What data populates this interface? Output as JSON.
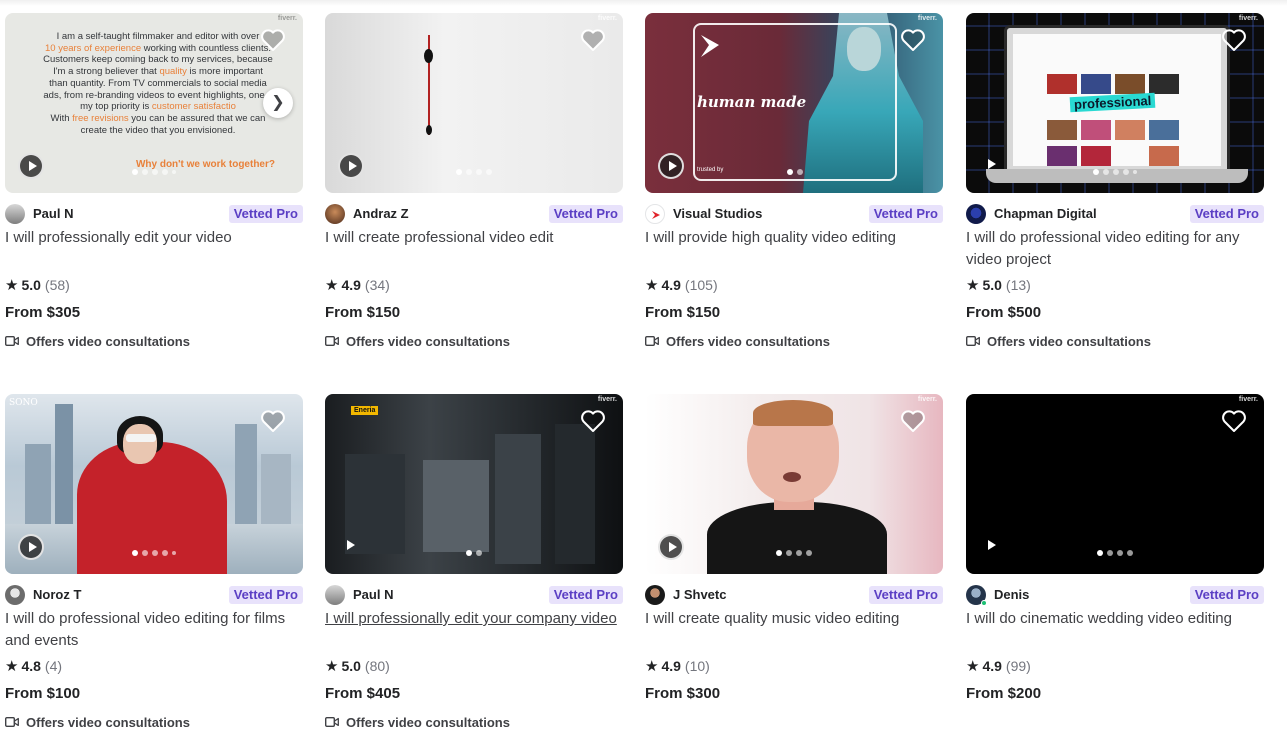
{
  "cards": [
    {
      "seller": "Paul N",
      "badge": "Vetted Pro",
      "title": "I will professionally edit your video",
      "rating": "5.0",
      "reviews": "(58)",
      "price": "From $305",
      "consultations": "Offers video consultations",
      "slide_count": 5,
      "thumbnail_text": {
        "line1": "I am a self-taught filmmaker and editor with over",
        "line2_highlight": "10 years of experience",
        "line2_rest": " working with countless clients.",
        "line3": "Customers keep coming back to my services, because",
        "line4_start": "I'm a strong believer that ",
        "line4_highlight": "quality",
        "line4_end": " is more important",
        "line5": "than quantity. From TV commercials to social media",
        "line6": "ads, from re-branding videos to event highlights, one o",
        "line7": "my top priority is ",
        "line7_highlight": "customer satisfactio",
        "line8_start": "With ",
        "line8_highlight": "free revisions",
        "line8_end": " you can be assured that we can",
        "line9": "create the video that you envisioned.",
        "cta": "Why don't we work together?"
      }
    },
    {
      "seller": "Andraz Z",
      "badge": "Vetted Pro",
      "title": "I will create professional video edit",
      "rating": "4.9",
      "reviews": "(34)",
      "price": "From $150",
      "consultations": "Offers video consultations",
      "slide_count": 4
    },
    {
      "seller": "Visual Studios",
      "badge": "Vetted Pro",
      "title": "I will provide high quality video editing",
      "rating": "4.9",
      "reviews": "(105)",
      "price": "From $150",
      "consultations": "Offers video consultations",
      "slide_count": 2,
      "thumbnail_text": {
        "headline": "human made",
        "trusted": "trusted by"
      }
    },
    {
      "seller": "Chapman Digital",
      "badge": "Vetted Pro",
      "title": "I will do professional video editing for any video project",
      "rating": "5.0",
      "reviews": "(13)",
      "price": "From $500",
      "consultations": "Offers video consultations",
      "slide_count": 5,
      "thumbnail_text": {
        "headline": "professional"
      }
    },
    {
      "seller": "Noroz T",
      "badge": "Vetted Pro",
      "title": "I will do professional video editing for films and events",
      "rating": "4.8",
      "reviews": "(4)",
      "price": "From $100",
      "consultations": "Offers video consultations",
      "slide_count": 5,
      "thumbnail_text": {
        "logo": "SONO"
      }
    },
    {
      "seller": "Paul N",
      "badge": "Vetted Pro",
      "title": "I will professionally edit your company video",
      "rating": "5.0",
      "reviews": "(80)",
      "price": "From $405",
      "consultations": "Offers video consultations",
      "slide_count": 2,
      "thumbnail_text": {
        "label": "Eneria"
      }
    },
    {
      "seller": "J Shvetc",
      "badge": "Vetted Pro",
      "title": "I will create quality music video editing",
      "rating": "4.9",
      "reviews": "(10)",
      "price": "From $300",
      "consultations": "",
      "slide_count": 4
    },
    {
      "seller": "Denis",
      "badge": "Vetted Pro",
      "title": "I will do cinematic wedding video editing",
      "rating": "4.9",
      "reviews": "(99)",
      "price": "From $200",
      "consultations": "",
      "slide_count": 4
    }
  ],
  "watermark": "fiverr.",
  "colors": {
    "badge_bg": "#e8e2fb",
    "badge_text": "#5b3fc4",
    "highlight_orange": "#e8813a",
    "online_green": "#1dbf73"
  },
  "icons": [
    "heart-icon",
    "play-icon",
    "star-icon",
    "video-camera-icon",
    "chevron-right-icon"
  ]
}
